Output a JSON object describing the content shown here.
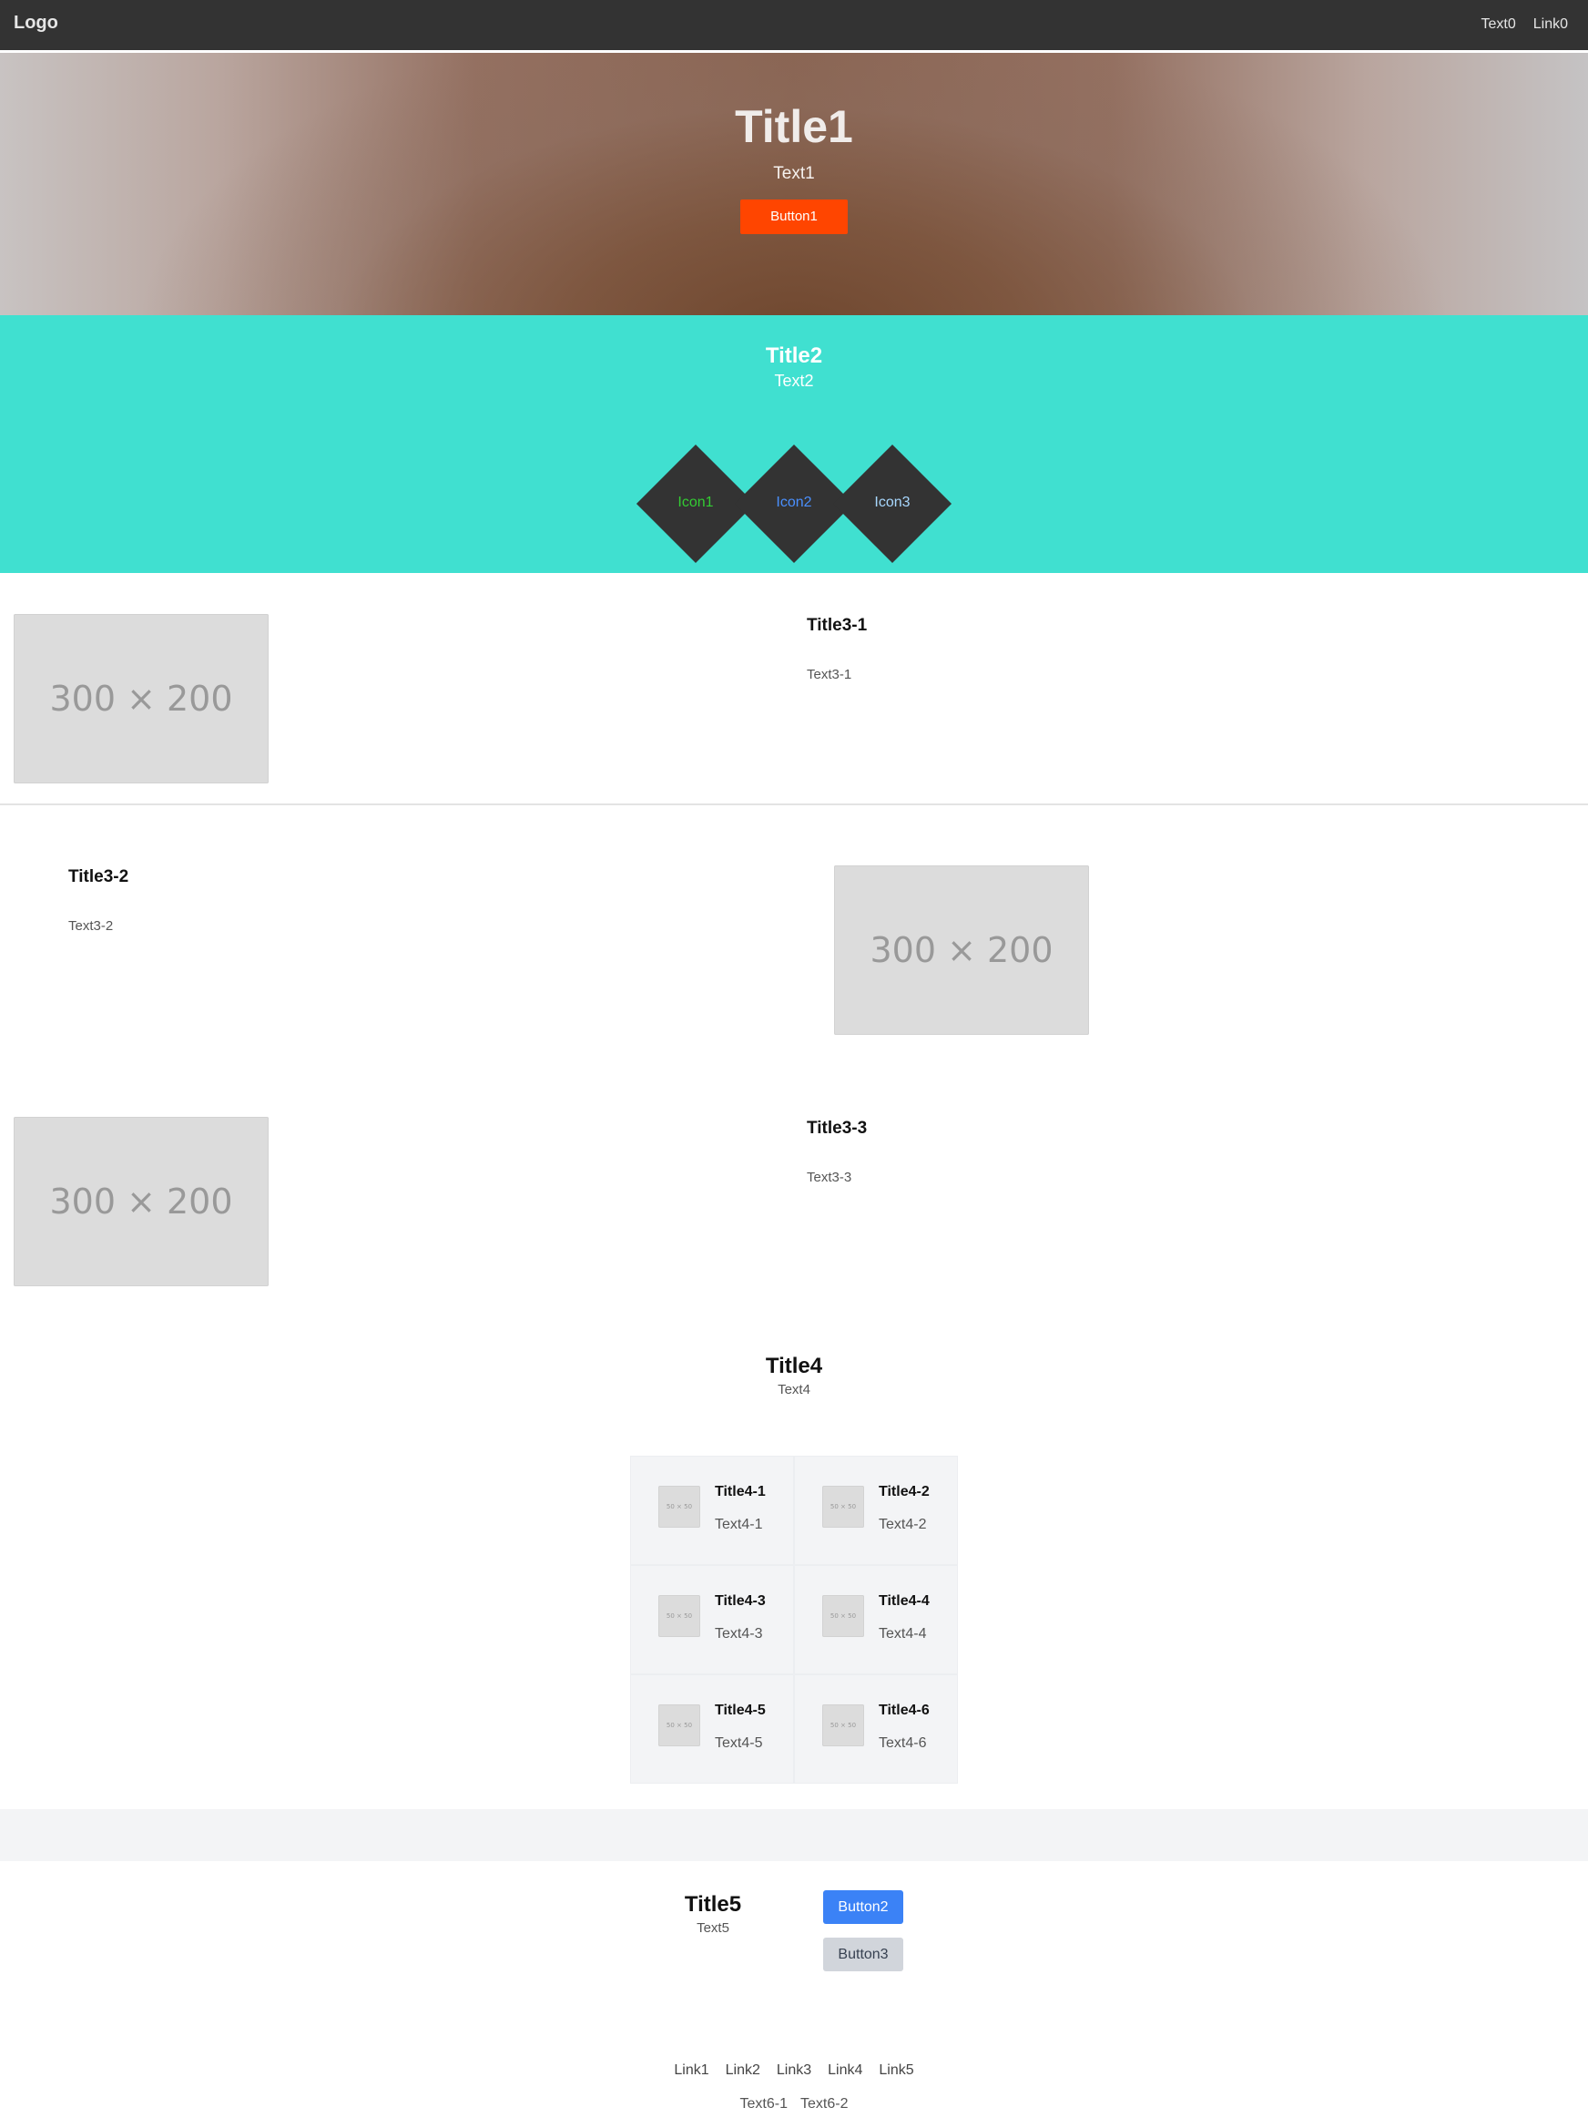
{
  "header": {
    "logo": "Logo",
    "text": "Text0",
    "link": "Link0"
  },
  "hero": {
    "title": "Title1",
    "text": "Text1",
    "button": "Button1"
  },
  "features": {
    "title": "Title2",
    "text": "Text2",
    "icons": [
      {
        "label": "Icon1",
        "color": "#33cc33"
      },
      {
        "label": "Icon2",
        "color": "#4a90ff"
      },
      {
        "label": "Icon3",
        "color": "#a8d8ff"
      }
    ]
  },
  "rows": [
    {
      "title": "Title3-1",
      "text": "Text3-1",
      "image": "300 × 200"
    },
    {
      "title": "Title3-2",
      "text": "Text3-2",
      "image": "300 × 200"
    },
    {
      "title": "Title3-3",
      "text": "Text3-3",
      "image": "300 × 200"
    }
  ],
  "grid": {
    "title": "Title4",
    "text": "Text4",
    "items": [
      {
        "title": "Title4-1",
        "text": "Text4-1",
        "image": "50 × 50"
      },
      {
        "title": "Title4-2",
        "text": "Text4-2",
        "image": "50 × 50"
      },
      {
        "title": "Title4-3",
        "text": "Text4-3",
        "image": "50 × 50"
      },
      {
        "title": "Title4-4",
        "text": "Text4-4",
        "image": "50 × 50"
      },
      {
        "title": "Title4-5",
        "text": "Text4-5",
        "image": "50 × 50"
      },
      {
        "title": "Title4-6",
        "text": "Text4-6",
        "image": "50 × 50"
      }
    ]
  },
  "cta": {
    "title": "Title5",
    "text": "Text5",
    "primary": "Button2",
    "secondary": "Button3"
  },
  "footer": {
    "links": [
      "Link1",
      "Link2",
      "Link3",
      "Link4",
      "Link5"
    ],
    "texts": [
      "Text6-1",
      "Text6-2"
    ]
  }
}
